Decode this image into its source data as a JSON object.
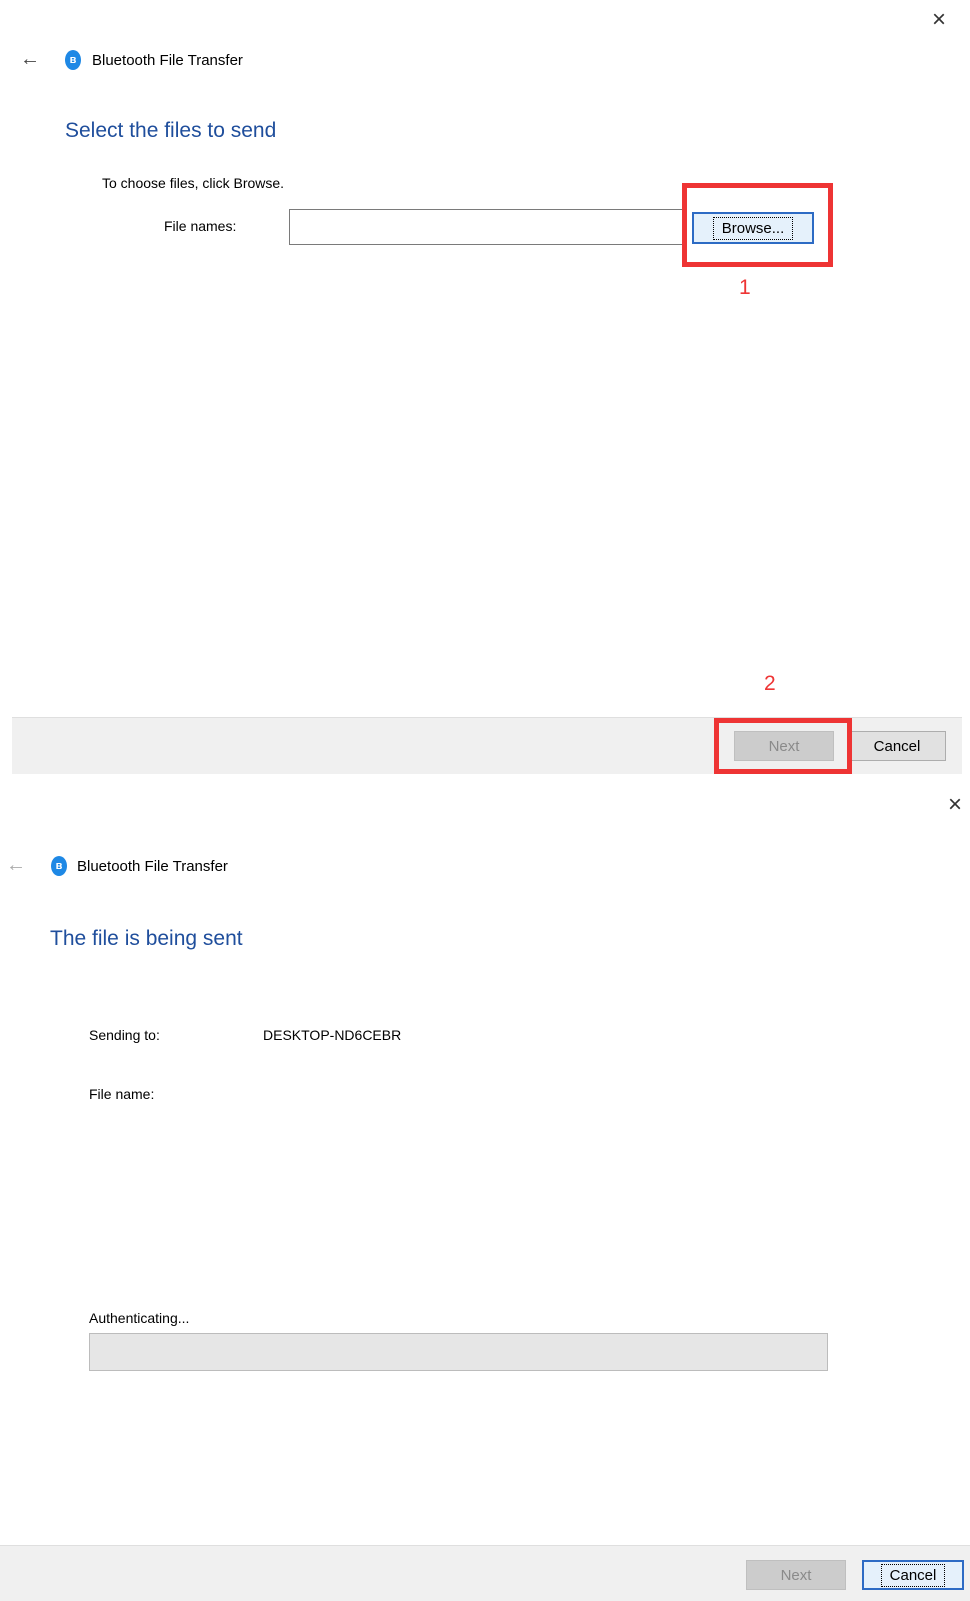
{
  "panel1": {
    "close_glyph": "×",
    "back_glyph": "←",
    "bluetooth_glyph": "ʙ",
    "app_title": "Bluetooth File Transfer",
    "heading": "Select the files to send",
    "instruction": "To choose files, click Browse.",
    "file_names_label": "File names:",
    "file_names_value": "",
    "browse_label": "Browse...",
    "next_label": "Next",
    "cancel_label": "Cancel",
    "annotation_1": "1",
    "annotation_2": "2",
    "annotation_color": "#ee3434"
  },
  "panel2": {
    "close_glyph": "×",
    "back_glyph": "←",
    "bluetooth_glyph": "ʙ",
    "app_title": "Bluetooth File Transfer",
    "heading": "The file is being sent",
    "sending_to_label": "Sending to:",
    "sending_to_value": "DESKTOP-ND6CEBR",
    "file_name_label": "File name:",
    "status": "Authenticating...",
    "progress": 0,
    "next_label": "Next",
    "cancel_label": "Cancel"
  },
  "colors": {
    "heading": "#1f4e9c",
    "bluetooth": "#1e88e5",
    "focus_border": "#2d6bc4"
  },
  "icons": {
    "close": "close-icon",
    "back": "back-arrow-icon",
    "bluetooth": "bluetooth-icon"
  }
}
